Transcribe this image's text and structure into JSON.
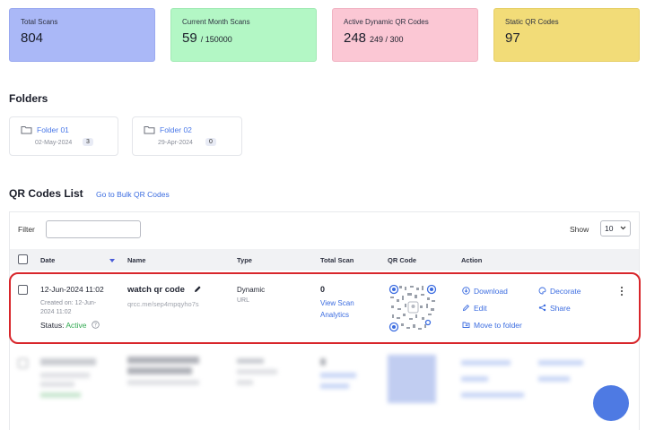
{
  "stats": {
    "total_scans": {
      "label": "Total Scans",
      "value": "804"
    },
    "current_month": {
      "label": "Current Month Scans",
      "value": "59",
      "limit": "/ 150000"
    },
    "active_dynamic": {
      "label": "Active Dynamic QR Codes",
      "value": "248",
      "limit": "249 / 300"
    },
    "static": {
      "label": "Static QR Codes",
      "value": "97"
    }
  },
  "folders": {
    "title": "Folders",
    "items": [
      {
        "name": "Folder 01",
        "date": "02-May-2024",
        "count": "3"
      },
      {
        "name": "Folder 02",
        "date": "29-Apr-2024",
        "count": "0"
      }
    ]
  },
  "list": {
    "title": "QR Codes List",
    "bulk_link": "Go to Bulk QR Codes",
    "filter_label": "Filter",
    "filter_value": "",
    "show_label": "Show",
    "show_value": "10",
    "columns": {
      "date": "Date",
      "name": "Name",
      "type": "Type",
      "total_scan": "Total Scan",
      "qr_code": "QR Code",
      "action": "Action"
    },
    "row": {
      "date": "12-Jun-2024 11:02",
      "created_line1": "Created on: 12-Jun-",
      "created_line2": "2024 11:02",
      "status_label": "Status:",
      "status_value": "Active",
      "name": "watch qr code",
      "url": "qrcc.me/sep4mpqyho7s",
      "type": "Dynamic",
      "subtype": "URL",
      "total_scan": "0",
      "view_analytics_1": "View Scan",
      "view_analytics_2": "Analytics",
      "actions": {
        "download": "Download",
        "decorate": "Decorate",
        "edit": "Edit",
        "share": "Share",
        "move": "Move to folder"
      }
    }
  },
  "colors": {
    "accent": "#3b6ce0",
    "active": "#2fa84f",
    "highlight": "#d8262b"
  }
}
